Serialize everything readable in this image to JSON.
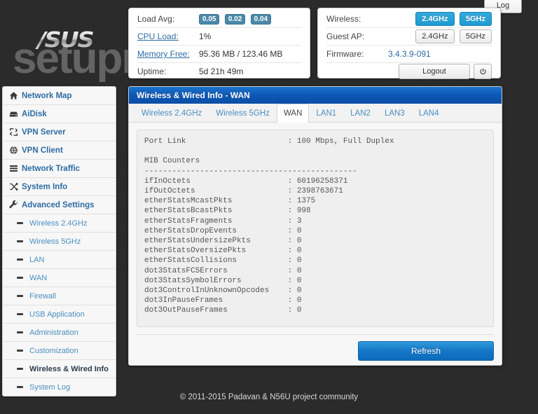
{
  "top": {
    "log_label": "Log"
  },
  "brand": {
    "logo_text": "/SUS",
    "watermark": "setuprouter"
  },
  "status": {
    "load_avg_label": "Load Avg:",
    "load_avg": [
      "0.05",
      "0.02",
      "0.04"
    ],
    "cpu_label": "CPU Load:",
    "cpu_value": "1%",
    "memory_label": "Memory Free:",
    "memory_value": "95.36 MB / 123.46 MB",
    "uptime_label": "Uptime:",
    "uptime_value": "5d 21h 49m"
  },
  "wireless": {
    "wireless_label": "Wireless:",
    "wireless_24": "2.4GHz",
    "wireless_5": "5GHz",
    "guest_label": "Guest AP:",
    "guest_24": "2.4GHz",
    "guest_5": "5GHz",
    "firmware_label": "Firmware:",
    "firmware_value": "3.4.3.9-091",
    "logout_label": "Logout",
    "power_icon": "power-icon"
  },
  "sidebar": {
    "items": [
      {
        "label": "Network Map",
        "icon": "home-icon",
        "sub": false
      },
      {
        "label": "AiDisk",
        "icon": "hard-drive-icon",
        "sub": false
      },
      {
        "label": "VPN Server",
        "icon": "exchange-icon",
        "sub": false
      },
      {
        "label": "VPN Client",
        "icon": "globe-icon",
        "sub": false
      },
      {
        "label": "Network Traffic",
        "icon": "server-list-icon",
        "sub": false
      },
      {
        "label": "System Info",
        "icon": "shuffle-icon",
        "sub": false
      },
      {
        "label": "Advanced Settings",
        "icon": "wrench-icon",
        "sub": false
      },
      {
        "label": "Wireless 2.4GHz",
        "icon": "dash-icon",
        "sub": true
      },
      {
        "label": "Wireless 5GHz",
        "icon": "dash-icon",
        "sub": true
      },
      {
        "label": "LAN",
        "icon": "dash-icon",
        "sub": true
      },
      {
        "label": "WAN",
        "icon": "dash-icon",
        "sub": true
      },
      {
        "label": "Firewall",
        "icon": "dash-icon",
        "sub": true
      },
      {
        "label": "USB Application",
        "icon": "dash-icon",
        "sub": true
      },
      {
        "label": "Administration",
        "icon": "dash-icon",
        "sub": true
      },
      {
        "label": "Customization",
        "icon": "dash-icon",
        "sub": true
      },
      {
        "label": "Wireless & Wired Info",
        "icon": "dash-icon",
        "sub": true,
        "current": true
      },
      {
        "label": "System Log",
        "icon": "dash-icon",
        "sub": true
      }
    ]
  },
  "main": {
    "title": "Wireless & Wired Info - WAN",
    "tabs": [
      {
        "label": "Wireless 2.4GHz",
        "active": false
      },
      {
        "label": "Wireless 5GHz",
        "active": false
      },
      {
        "label": "WAN",
        "active": true
      },
      {
        "label": "LAN1",
        "active": false
      },
      {
        "label": "LAN2",
        "active": false
      },
      {
        "label": "LAN3",
        "active": false
      },
      {
        "label": "LAN4",
        "active": false
      }
    ],
    "report": "Port Link                      : 100 Mbps, Full Duplex\n\nMIB Counters\n----------------------------------------------\nifInOctets                     : 60196258371\nifOutOctets                    : 2398763671\netherStatsMcastPkts            : 1375\netherStatsBcastPkts            : 998\netherStatsFragments            : 3\netherStatsDropEvents           : 0\netherStatsUndersizePkts        : 0\netherStatsOversizePkts         : 0\netherStatsCollisions           : 0\ndot3StatsFCSErrors             : 0\ndot3StatsSymbolErrors          : 0\ndot3ControlInUnknownOpcodes    : 0\ndot3InPauseFrames              : 0\ndot3OutPauseFrames             : 0",
    "refresh_label": "Refresh"
  },
  "footer": {
    "copyright": "© 2011-2015 Padavan & N56U project community"
  }
}
